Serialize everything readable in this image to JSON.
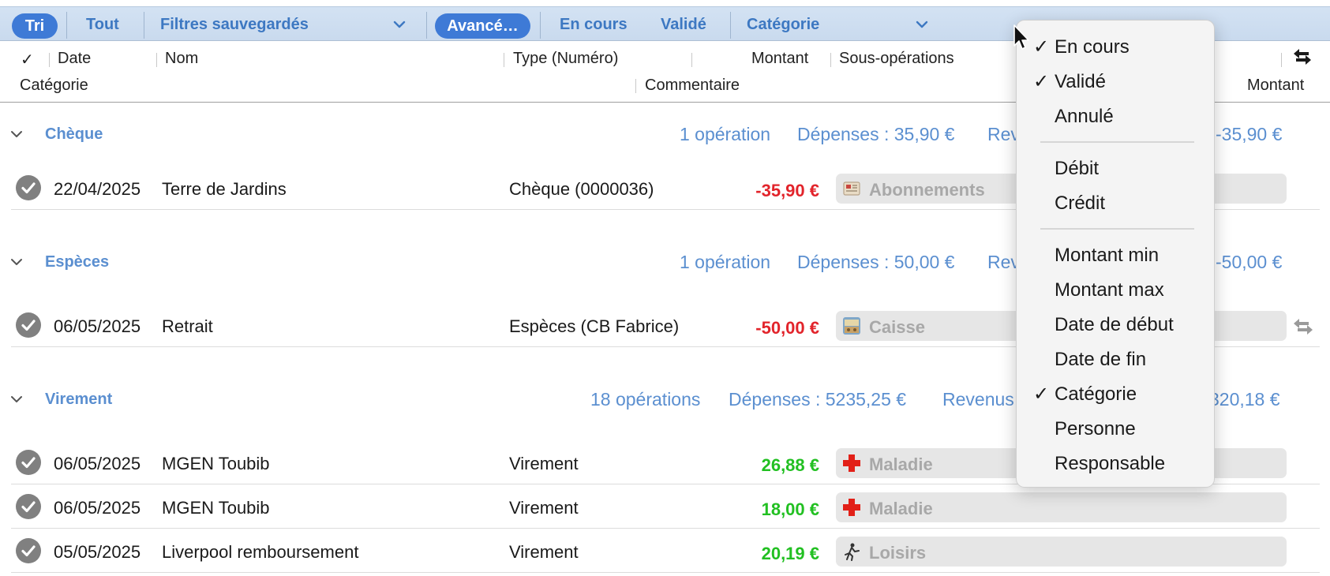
{
  "filter_bar": {
    "sort_label": "Tri",
    "all_label": "Tout",
    "saved_filters_label": "Filtres sauvegardés",
    "advanced_label": "Avancé…",
    "in_progress_label": "En cours",
    "validated_label": "Validé",
    "category_label": "Catégorie"
  },
  "columns": {
    "check": "✓",
    "date": "Date",
    "name": "Nom",
    "type": "Type (Numéro)",
    "amount": "Montant",
    "sub_operations": "Sous-opérations",
    "category": "Catégorie",
    "comment": "Commentaire",
    "amount2": "Montant"
  },
  "groups": [
    {
      "name": "Chèque",
      "count": "1 opération",
      "expenses": "Dépenses : 35,90 €",
      "revenue": "Rev",
      "total": "-35,90 €",
      "rows": [
        {
          "date": "22/04/2025",
          "name": "Terre de Jardins",
          "type": "Chèque (0000036)",
          "amount": "-35,90 €",
          "category": "Abonnements",
          "icon": "newspaper-icon"
        }
      ]
    },
    {
      "name": "Espèces",
      "count": "1 opération",
      "expenses": "Dépenses : 50,00 €",
      "revenue": "Rev",
      "total": "-50,00 €",
      "rows": [
        {
          "date": "06/05/2025",
          "name": "Retrait",
          "type": "Espèces (CB Fabrice)",
          "amount": "-50,00 €",
          "category": "Caisse",
          "icon": "cash-register-icon"
        }
      ]
    },
    {
      "name": "Virement",
      "count": "18 opérations",
      "expenses": "Dépenses : 5235,25 €",
      "revenue": "Revenus",
      "total": "320,18 €",
      "rows": [
        {
          "date": "06/05/2025",
          "name": "MGEN Toubib",
          "type": "Virement",
          "amount": "26,88 €",
          "category": "Maladie",
          "icon": "red-cross-icon"
        },
        {
          "date": "06/05/2025",
          "name": "MGEN Toubib",
          "type": "Virement",
          "amount": "18,00 €",
          "category": "Maladie",
          "icon": "red-cross-icon"
        },
        {
          "date": "05/05/2025",
          "name": "Liverpool remboursement",
          "type": "Virement",
          "amount": "20,19 €",
          "category": "Loisirs",
          "icon": "leisure-icon"
        }
      ]
    }
  ],
  "menu": {
    "items": [
      {
        "label": "En cours",
        "checked": "✓"
      },
      {
        "label": "Validé",
        "checked": "✓"
      },
      {
        "label": "Annulé",
        "checked": ""
      },
      {
        "label": "Débit",
        "checked": ""
      },
      {
        "label": "Crédit",
        "checked": ""
      },
      {
        "label": "Montant min",
        "checked": ""
      },
      {
        "label": "Montant max",
        "checked": ""
      },
      {
        "label": "Date de début",
        "checked": ""
      },
      {
        "label": "Date de fin",
        "checked": ""
      },
      {
        "label": "Catégorie",
        "checked": "✓"
      },
      {
        "label": "Personne",
        "checked": ""
      },
      {
        "label": "Responsable",
        "checked": ""
      }
    ]
  },
  "colors": {
    "accent": "#3e7ad6",
    "group_text": "#5b8fd0",
    "negative": "#e2242b",
    "positive": "#22c022"
  }
}
